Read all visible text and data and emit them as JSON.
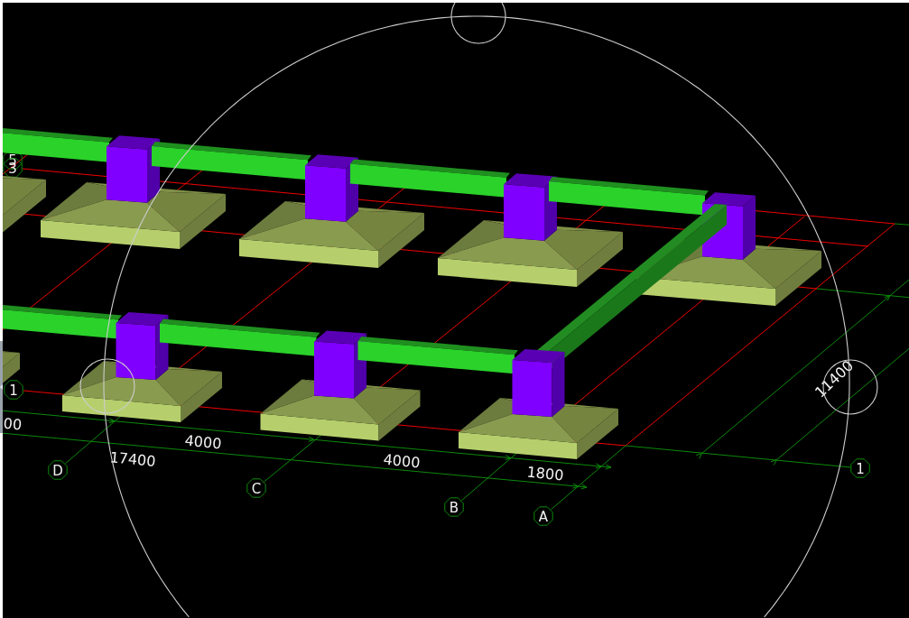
{
  "viewport": {
    "grid_axis_labels": [
      "5",
      "3",
      "1",
      "D",
      "C",
      "B",
      "A",
      "1"
    ],
    "dimension_labels": [
      "00",
      "4000",
      "17400",
      "4000",
      "1800",
      "11400"
    ]
  }
}
